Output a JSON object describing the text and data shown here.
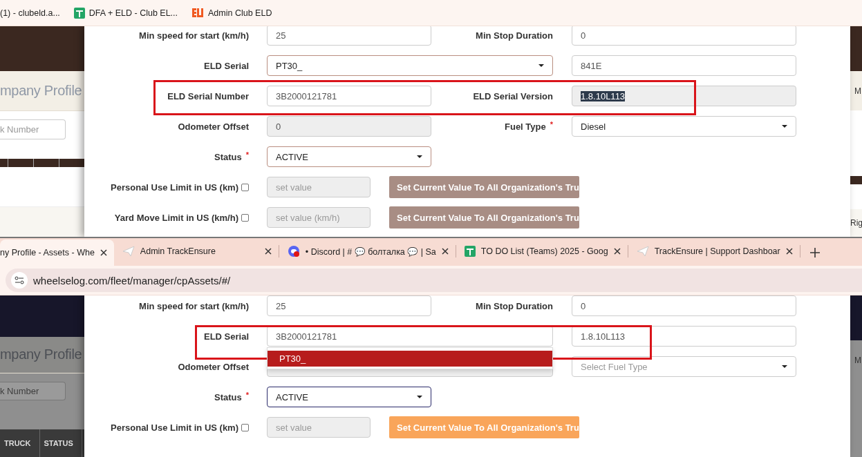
{
  "bookmarks_bar": {
    "bookmarks": [
      {
        "label": "(1) - clubeld.a...",
        "kind": "plain"
      },
      {
        "label": "DFA + ELD - Club EL...",
        "kind": "sheets"
      },
      {
        "label": "Admin Club ELD",
        "kind": "eld"
      }
    ]
  },
  "top_screen": {
    "left_panel": {
      "heading": "mpany Profile",
      "search": {
        "placeholder": "k Number"
      }
    },
    "form": {
      "rows": [
        {
          "label": "Min speed for start (km/h)",
          "field": {
            "kind": "input",
            "value": "25"
          },
          "label_2": "Min Stop Duration",
          "field_2": {
            "kind": "input",
            "value": "0"
          }
        },
        {
          "label": "ELD Serial",
          "field": {
            "kind": "select",
            "value": "PT30_",
            "outlined": true
          },
          "field_2": {
            "kind": "input",
            "value": "841E"
          }
        },
        {
          "label": "ELD Serial Number",
          "annotated": true,
          "field": {
            "kind": "input",
            "value": "3B2000121781"
          },
          "label_2": "ELD Serial Version",
          "field_2": {
            "kind": "readonly",
            "value": "1.8.10L113",
            "text_selected": true
          }
        },
        {
          "label": "Odometer Offset",
          "field": {
            "kind": "readonly",
            "value": "0"
          },
          "label_2": "Fuel Type",
          "required_mark_2": "*",
          "field_2": {
            "kind": "select",
            "value": "Diesel"
          }
        },
        {
          "label": "Status",
          "required_mark": "*",
          "field": {
            "kind": "select",
            "value": "ACTIVE",
            "outlined": true
          }
        },
        {
          "label": "Personal Use Limit in US (km)",
          "checkbox": {
            "checked": false
          },
          "field": {
            "kind": "readonly",
            "placeholder": "set value"
          },
          "button": {
            "label": "Set Current Value To All Organization's Tru",
            "disabled": true
          }
        },
        {
          "label": "Yard Move Limit in US (km/h)",
          "checkbox": {
            "checked": false
          },
          "field": {
            "kind": "readonly",
            "placeholder": "set value (km/h)"
          },
          "button": {
            "label": "Set Current Value To All Organization's Tru",
            "disabled": true
          }
        }
      ]
    },
    "right_panel": {
      "labels": [
        "M",
        "Rig"
      ]
    }
  },
  "browser": {
    "tabs": [
      {
        "label": "ny Profile - Assets - Whe",
        "kind": "page",
        "selected": true
      },
      {
        "label": "Admin TrackEnsure",
        "kind": "trackensure",
        "selected": false
      },
      {
        "label": "• Discord | # 💬 болталка 💬 | Sa",
        "kind": "discord",
        "selected": false
      },
      {
        "label": "TO DO List (Teams) 2025 - Goog",
        "kind": "sheets",
        "selected": false
      },
      {
        "label": "TrackEnsure | Support Dashboar",
        "kind": "trackensure",
        "selected": false
      }
    ],
    "address": "wheelselog.com/fleet/manager/cpAssets/#/"
  },
  "bottom_screen": {
    "left_panel": {
      "heading": "mpany Profile",
      "search": {
        "placeholder": "k Number"
      },
      "columns": [
        "TRUCK",
        "STATUS"
      ]
    },
    "form": {
      "rows": [
        {
          "label": "Min speed for start (km/h)",
          "field": {
            "kind": "input",
            "value": "25"
          },
          "label_2": "Min Stop Duration",
          "field_2": {
            "kind": "input",
            "value": "0"
          }
        },
        {
          "label": "ELD Serial",
          "annotated": true,
          "field": {
            "kind": "input",
            "value": "3B2000121781"
          },
          "field_2": {
            "kind": "input",
            "value": "1.8.10L113"
          },
          "dropdown": {
            "options": [
              {
                "label": "PT30_",
                "selected": true
              }
            ]
          }
        },
        {
          "label": "Odometer Offset",
          "field": {
            "kind": "readonly"
          },
          "field_2": {
            "kind": "select",
            "placeholder": "Select Fuel Type"
          }
        },
        {
          "label": "Status",
          "required_mark": "*",
          "field": {
            "kind": "select",
            "value": "ACTIVE",
            "outlined": true
          }
        },
        {
          "label": "Personal Use Limit in US (km)",
          "checkbox": {
            "checked": false
          },
          "field": {
            "kind": "readonly",
            "placeholder": "set value"
          },
          "button": {
            "label": "Set Current Value To All Organization's Tru",
            "disabled": false
          }
        }
      ]
    },
    "right_panel": {
      "labels": [
        "M"
      ]
    }
  }
}
